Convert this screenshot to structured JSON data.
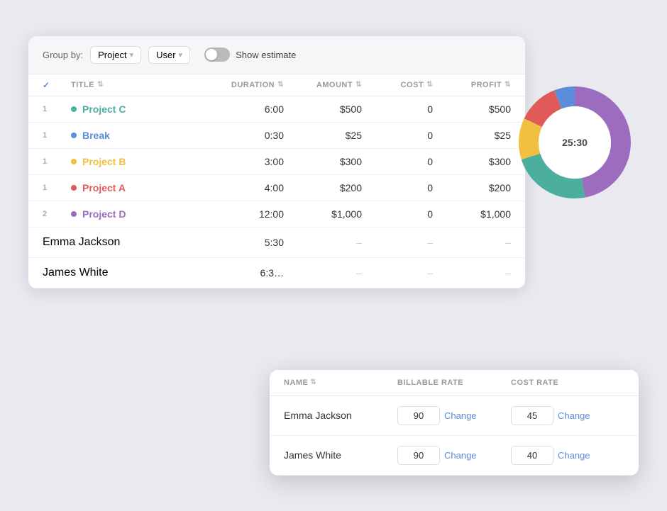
{
  "toolbar": {
    "group_by_label": "Group by:",
    "group_project": "Project",
    "group_user": "User",
    "show_estimate": "Show estimate",
    "toggle_active": false
  },
  "table": {
    "columns": [
      "",
      "TITLE",
      "DURATION",
      "AMOUNT",
      "COST",
      "PROFIT"
    ],
    "rows": [
      {
        "num": "1",
        "title": "Project C",
        "color": "#4caf9e",
        "duration": "6:00",
        "amount": "$500",
        "cost": "0",
        "profit": "$500"
      },
      {
        "num": "1",
        "title": "Break",
        "color": "#5b8dd9",
        "duration": "0:30",
        "amount": "$25",
        "cost": "0",
        "profit": "$25"
      },
      {
        "num": "1",
        "title": "Project B",
        "color": "#f0c040",
        "duration": "3:00",
        "amount": "$300",
        "cost": "0",
        "profit": "$300"
      },
      {
        "num": "1",
        "title": "Project A",
        "color": "#e05a5a",
        "duration": "4:00",
        "amount": "$200",
        "cost": "0",
        "profit": "$200"
      },
      {
        "num": "2",
        "title": "Project D",
        "color": "#9c6dbf",
        "duration": "12:00",
        "amount": "$1,000",
        "cost": "0",
        "profit": "$1,000"
      }
    ],
    "person_rows": [
      {
        "name": "Emma Jackson",
        "duration": "5:30",
        "amount": "–",
        "cost": "–",
        "profit": "–"
      },
      {
        "name": "James White",
        "duration": "6:3",
        "amount": "–",
        "cost": "–",
        "profit": "–"
      }
    ]
  },
  "chart": {
    "center_label": "25:30",
    "segments": [
      {
        "color": "#9c6dbf",
        "pct": 47
      },
      {
        "color": "#4caf9e",
        "pct": 23
      },
      {
        "color": "#f0c040",
        "pct": 12
      },
      {
        "color": "#e05a5a",
        "pct": 12
      },
      {
        "color": "#5b8dd9",
        "pct": 6
      }
    ]
  },
  "rate_table": {
    "columns": [
      "NAME",
      "BILLABLE RATE",
      "COST RATE"
    ],
    "rows": [
      {
        "name": "Emma Jackson",
        "billable_rate": "90",
        "cost_rate": "45"
      },
      {
        "name": "James White",
        "billable_rate": "90",
        "cost_rate": "40"
      }
    ],
    "change_label": "Change"
  }
}
